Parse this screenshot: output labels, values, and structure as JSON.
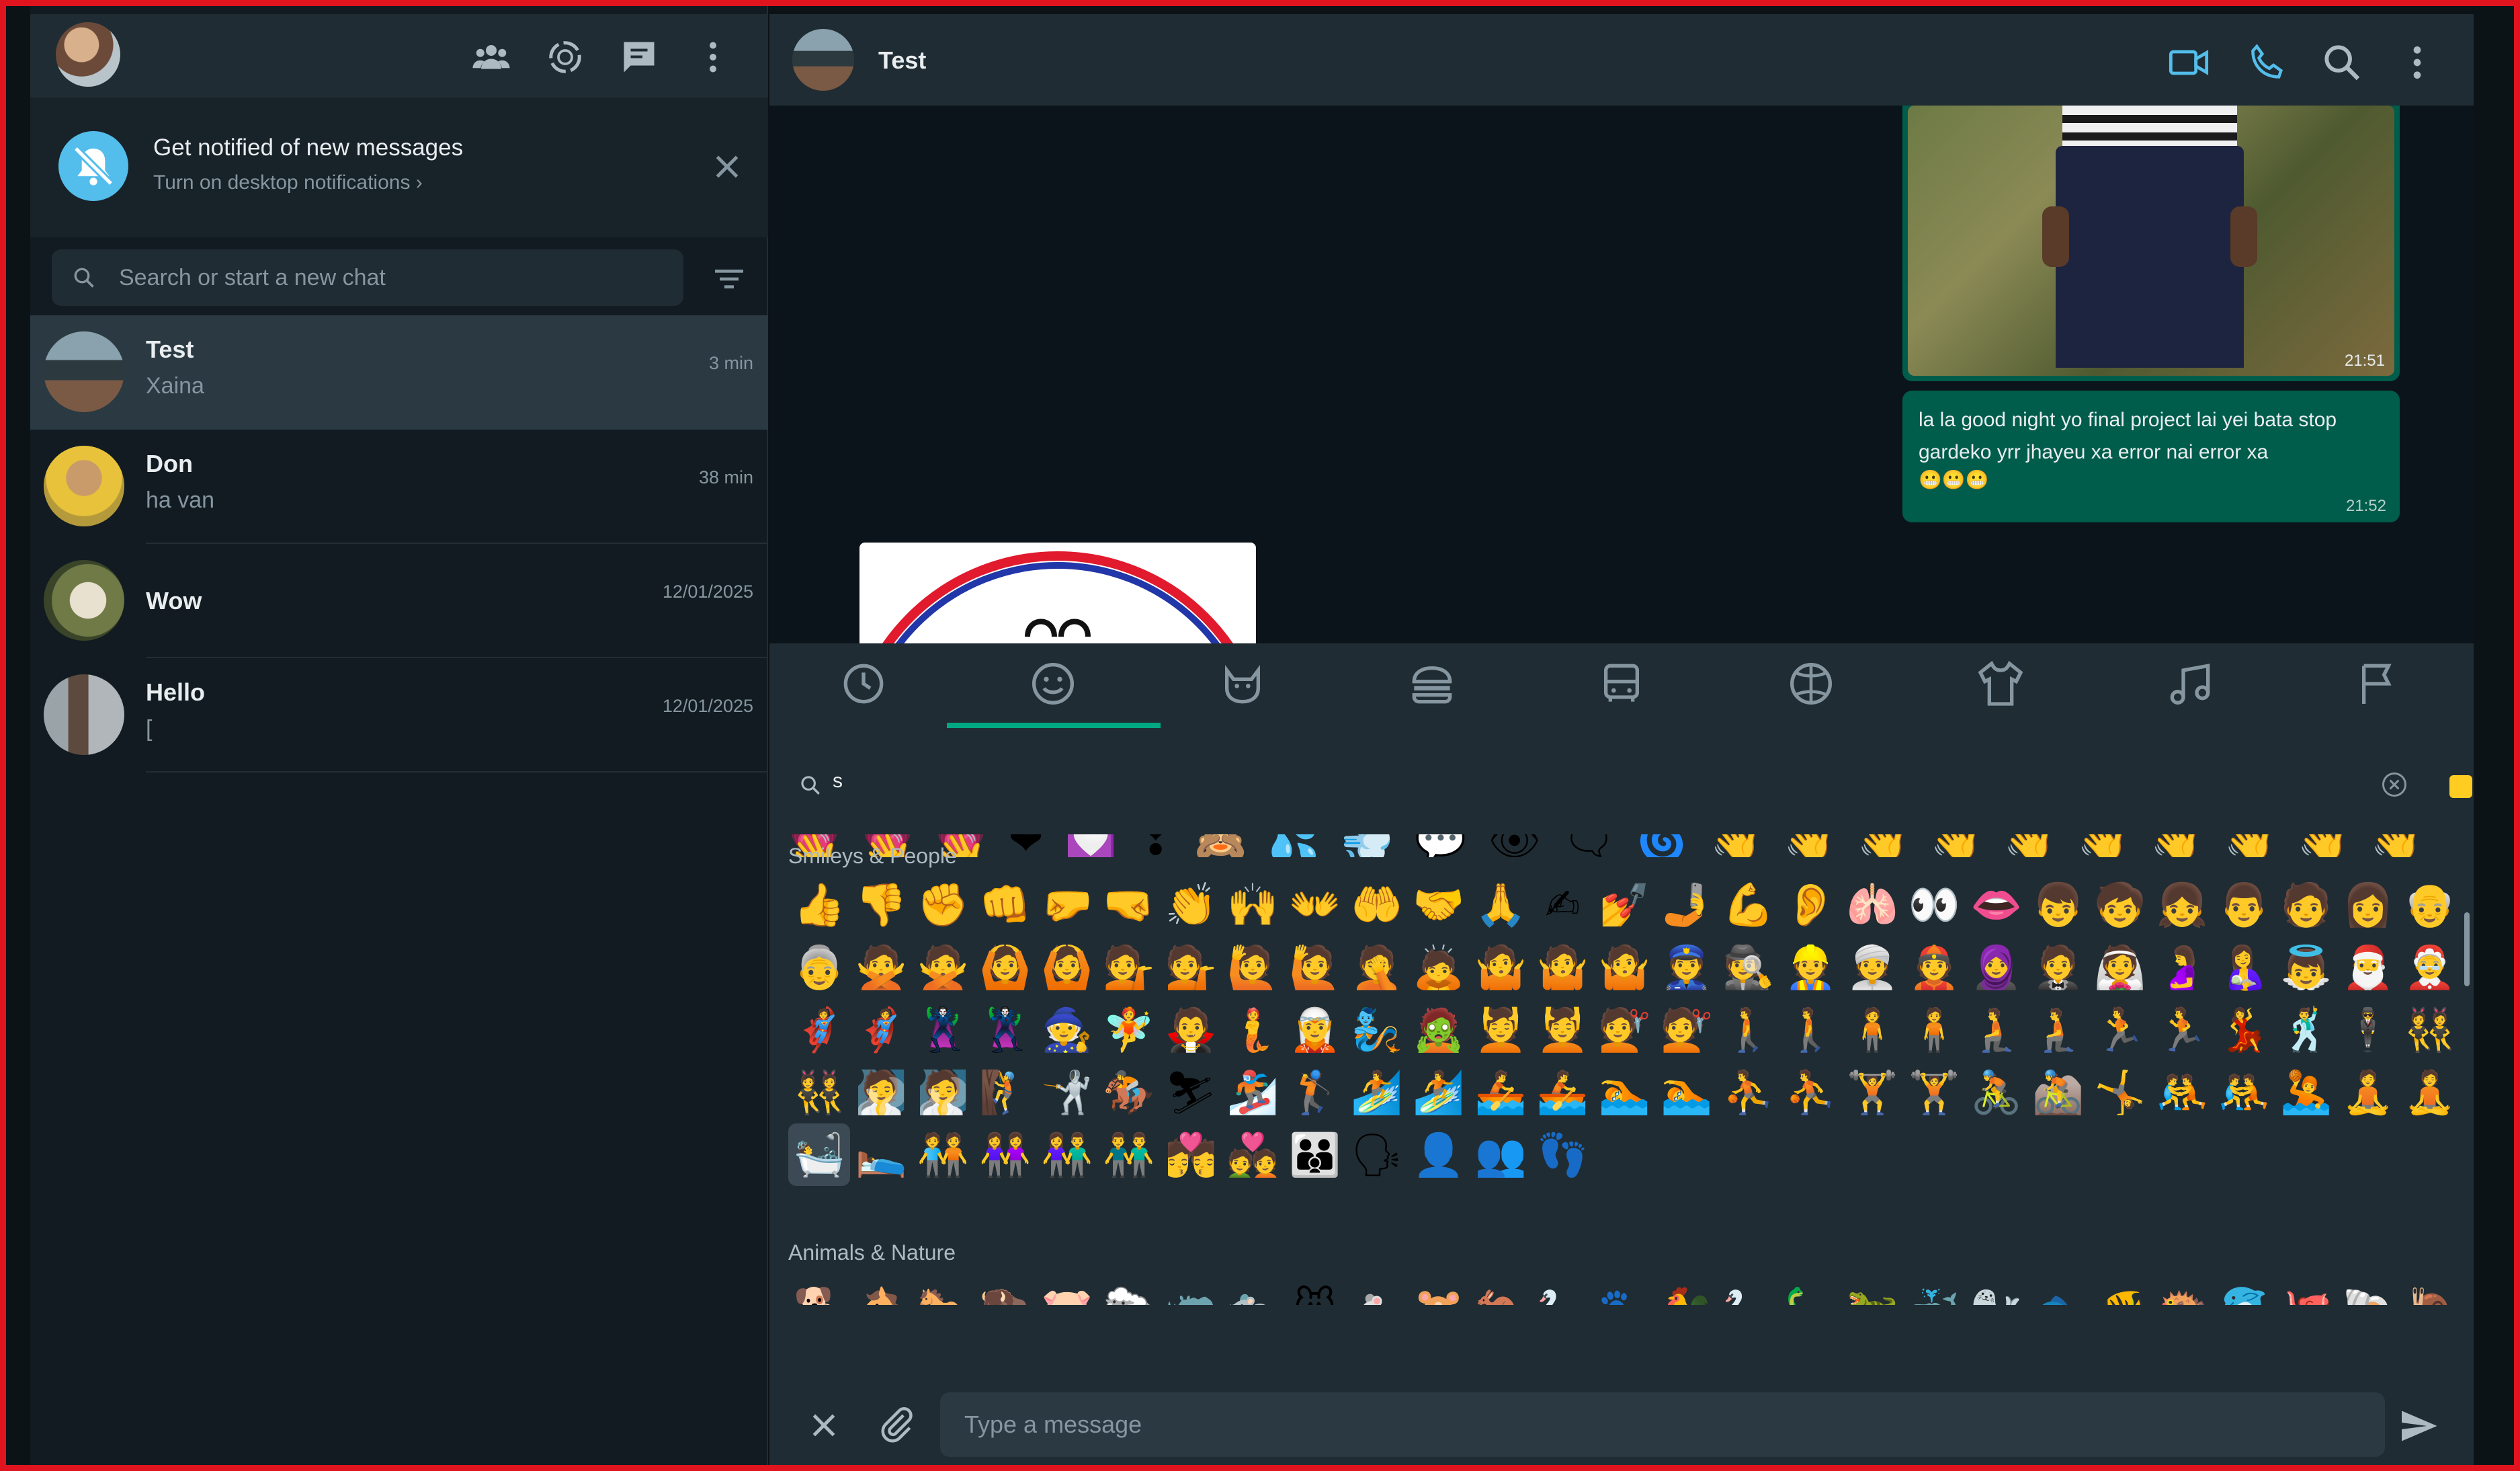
{
  "notification": {
    "title": "Get notified of new messages",
    "subtitle": "Turn on desktop notifications ›"
  },
  "search": {
    "placeholder": "Search or start a new chat"
  },
  "chats": [
    {
      "name": "Test",
      "preview": "Xaina",
      "time": "3 min"
    },
    {
      "name": "Don",
      "preview": "ha van",
      "time": "38 min"
    },
    {
      "name": "Wow",
      "preview": "",
      "time": "12/01/2025"
    },
    {
      "name": "Hello",
      "preview": "[",
      "time": "12/01/2025"
    }
  ],
  "conversation": {
    "title": "Test",
    "image_message_time": "21:51",
    "text_message": "la la good night yo final project lai yei bata stop gardeko yrr jhayeu xa error nai error xa",
    "text_message_emoji": "😬😬😬",
    "text_message_time": "21:52"
  },
  "emoji_picker": {
    "search_value": "s",
    "sections": {
      "smileys_people": "Smileys & People",
      "animals_nature": "Animals & Nature"
    },
    "peek_row": "💗💗💗❤💟❣🙈💦💨💬👁🗨🌀👋👋👋👋👋👋👋👋👋👋👋👋👋",
    "smileys_people_emojis": [
      "👍",
      "👎",
      "✊",
      "👊",
      "🤛",
      "🤜",
      "👏",
      "🙌",
      "👐",
      "🤲",
      "🤝",
      "🙏",
      "✍",
      "💅",
      "🤳",
      "💪",
      "👂",
      "🫁",
      "👀",
      "👄",
      "👦",
      "🧒",
      "👧",
      "👨",
      "🧑",
      "👩",
      "👴",
      "👵",
      "🙅",
      "🙅",
      "🙆",
      "🙆",
      "💁",
      "💁",
      "🙋",
      "🙋",
      "🤦",
      "🙇",
      "🤷",
      "🤷",
      "🤷",
      "👮",
      "🕵",
      "👷",
      "👳",
      "👲",
      "🧕",
      "🤵",
      "👰",
      "🤰",
      "🤱",
      "👼",
      "🎅",
      "🤶",
      "🦸",
      "🦸",
      "🦹",
      "🦹",
      "🧙",
      "🧚",
      "🧛",
      "🧜",
      "🧝",
      "🧞",
      "🧟",
      "💆",
      "💆",
      "💇",
      "💇",
      "🚶",
      "🚶",
      "🧍",
      "🧍",
      "🧎",
      "🧎",
      "🏃",
      "🏃",
      "💃",
      "🕺",
      "🕴",
      "👯",
      "👯",
      "🧖",
      "🧖",
      "🧗",
      "🤺",
      "🏇",
      "⛷",
      "🏂",
      "🏌",
      "🏄",
      "🏄",
      "🚣",
      "🚣",
      "🏊",
      "🏊",
      "⛹",
      "⛹",
      "🏋",
      "🏋",
      "🚴",
      "🚵",
      "🤸",
      "🤼",
      "🤼",
      "🤽",
      "🧘",
      "🧘",
      "🛀",
      "🛌",
      "🧑‍🤝‍🧑",
      "👭",
      "👫",
      "👬",
      "💏",
      "💑",
      "👪",
      "🗣",
      "👤",
      "👥",
      "👣"
    ],
    "animals_nature_emojis": [
      "🐕",
      "🐴",
      "🐎",
      "🦬",
      "🐷",
      "🐑",
      "🦏",
      "🐀",
      "🐭",
      "🐁",
      "🐹",
      "🦘",
      "🦢",
      "🐾",
      "🐓",
      "🦢",
      "🦕",
      "🦖",
      "🐳",
      "🦭",
      "🐟",
      "🐠",
      "🐡",
      "🐬",
      "🐙",
      "🐚",
      "🐌"
    ]
  },
  "composer": {
    "placeholder": "Type a message"
  },
  "colors": {
    "accent": "#00a884",
    "outgoing_bubble": "#005c4b",
    "panel": "#202c33",
    "background": "#111b21",
    "notify_icon": "#53bdeb",
    "frame_border": "#e0141e"
  }
}
